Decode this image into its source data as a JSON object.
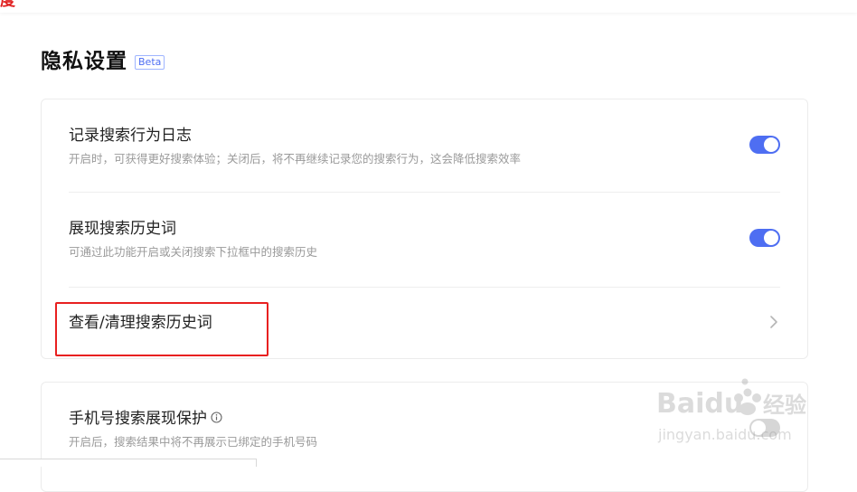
{
  "header": {
    "fragment_char": "度"
  },
  "page": {
    "title": "隐私设置",
    "badge": "Beta"
  },
  "settings": [
    {
      "title": "记录搜索行为日志",
      "desc": "开启时，可获得更好搜索体验；关闭后，将不再继续记录您的搜索行为，这会降低搜索效率",
      "toggle": "on"
    },
    {
      "title": "展现搜索历史词",
      "desc": "可通过此功能开启或关闭搜索下拉框中的搜索历史",
      "toggle": "on"
    },
    {
      "title": "查看/清理搜索历史词"
    }
  ],
  "phone_protection": {
    "title": "手机号搜索展现保护",
    "desc": "开启后，搜索结果中将不再展示已绑定的手机号码",
    "toggle": "off"
  },
  "watermark": {
    "brand": "Baidu",
    "cn": "经验",
    "url": "jingyan.baidu.com"
  },
  "colors": {
    "accent": "#4e6ef2",
    "highlight": "#e82020",
    "toggle_off": "#d6d6d6"
  },
  "icons": {
    "chevron": "chevron-right-icon",
    "info": "info-icon",
    "paw": "paw-icon"
  }
}
